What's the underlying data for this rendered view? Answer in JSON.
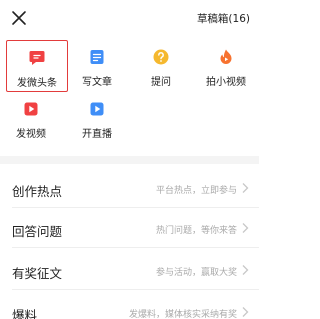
{
  "header": {
    "close_icon": "close-icon",
    "drafts_label": "草稿箱(16)"
  },
  "actions": [
    {
      "label": "发微头条",
      "icon": "chat-bubble-icon",
      "color": "#f04142",
      "selected": true
    },
    {
      "label": "写文章",
      "icon": "document-icon",
      "color": "#3f8ef7",
      "selected": false
    },
    {
      "label": "提问",
      "icon": "question-icon",
      "color": "#f5b82e",
      "selected": false
    },
    {
      "label": "拍小视频",
      "icon": "flame-play-icon",
      "color": "#f7722f",
      "selected": false
    },
    {
      "label": "发视频",
      "icon": "video-play-icon",
      "color": "#f04142",
      "selected": false
    },
    {
      "label": "开直播",
      "icon": "live-icon",
      "color": "#3f8ef7",
      "selected": false
    }
  ],
  "menu": [
    {
      "title": "创作热点",
      "hint": "平台热点，立即参与"
    },
    {
      "title": "回答问题",
      "hint": "热门问题，等你来答"
    },
    {
      "title": "有奖征文",
      "hint": "参与活动，赢取大奖"
    },
    {
      "title": "爆料",
      "hint": "发爆料，媒体核实采纳有奖"
    }
  ],
  "colors": {
    "accent_red": "#f04142",
    "accent_blue": "#3f8ef7",
    "accent_yellow": "#f5b82e",
    "accent_orange": "#f7722f",
    "hint_gray": "#aaaaaa"
  }
}
